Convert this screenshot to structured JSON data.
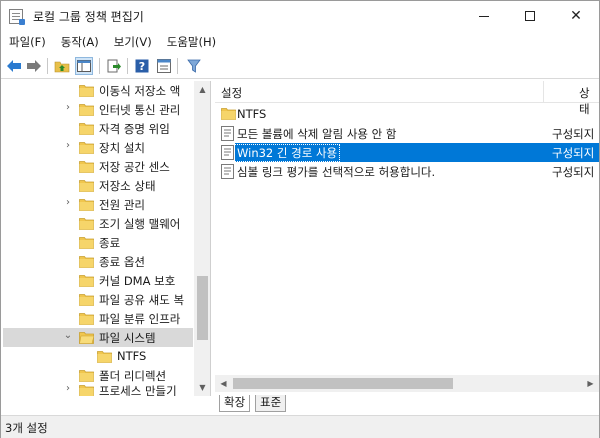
{
  "window": {
    "title": "로컬 그룹 정책 편집기",
    "controls": {
      "minimize": "minimize-icon",
      "maximize": "maximize-icon",
      "close": "✕"
    }
  },
  "menu": {
    "items": [
      "파일(F)",
      "동작(A)",
      "보기(V)",
      "도움말(H)"
    ]
  },
  "toolbar": {
    "icons": [
      "back-arrow-icon",
      "forward-arrow-icon",
      "up-folder-icon",
      "show-hide-tree-icon",
      "export-list-icon",
      "help-icon",
      "properties-icon",
      "filter-icon"
    ]
  },
  "tree": {
    "items": [
      {
        "label": "이동식 저장소 액",
        "expandable": false
      },
      {
        "label": "인터넷 통신 관리",
        "expandable": true
      },
      {
        "label": "자격 증명 위임",
        "expandable": false
      },
      {
        "label": "장치 설치",
        "expandable": true
      },
      {
        "label": "저장 공간 센스",
        "expandable": false
      },
      {
        "label": "저장소 상태",
        "expandable": false
      },
      {
        "label": "전원 관리",
        "expandable": true
      },
      {
        "label": "조기 실행 맬웨어",
        "expandable": false
      },
      {
        "label": "종료",
        "expandable": false
      },
      {
        "label": "종료 옵션",
        "expandable": false
      },
      {
        "label": "커널 DMA 보호",
        "expandable": false
      },
      {
        "label": "파일 공유 섀도 복",
        "expandable": false
      },
      {
        "label": "파일 분류 인프라",
        "expandable": false
      },
      {
        "label": "파일 시스템",
        "expandable": true,
        "expanded": true,
        "selected": true
      },
      {
        "label": "NTFS",
        "child": true
      },
      {
        "label": "폴더 리디렉션",
        "expandable": false
      },
      {
        "label": "프로세스 만들기",
        "expandable": false
      }
    ]
  },
  "list": {
    "columns": [
      "설정",
      "상태"
    ],
    "rows": [
      {
        "name": "NTFS",
        "state": "",
        "type": "folder"
      },
      {
        "name": "모든 볼륨에 삭제 알림 사용 안 함",
        "state": "구성되지",
        "type": "policy"
      },
      {
        "name": "Win32 긴 경로 사용",
        "state": "구성되지",
        "type": "policy",
        "selected": true
      },
      {
        "name": "심볼 링크 평가를 선택적으로 허용합니다.",
        "state": "구성되지",
        "type": "policy"
      }
    ]
  },
  "tabs": [
    "확장",
    "표준"
  ],
  "status": {
    "text": "3개 설정"
  },
  "colors": {
    "selection": "#0078d7",
    "folder": "#e8c04a"
  }
}
